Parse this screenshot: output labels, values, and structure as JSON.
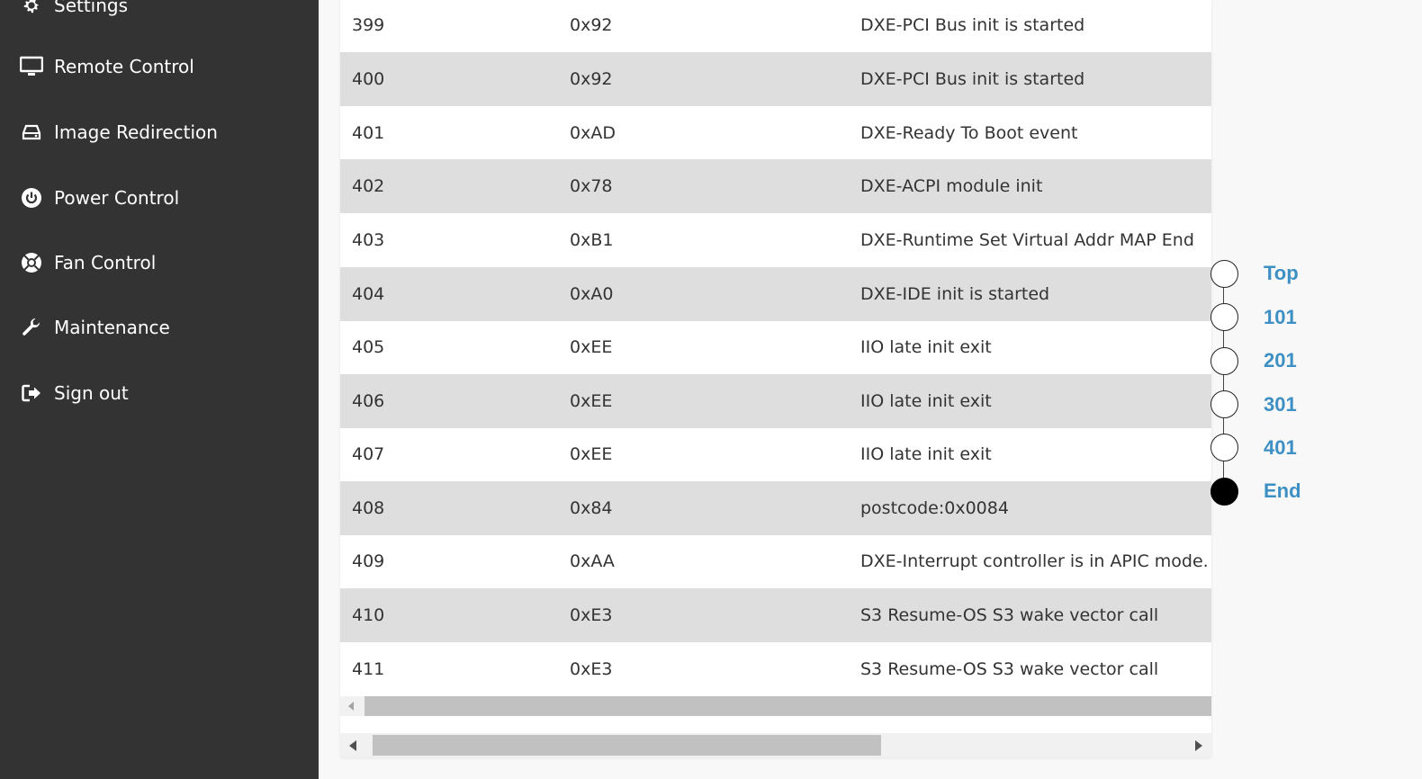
{
  "sidebar": {
    "items": [
      {
        "label": "Settings",
        "icon": "gear-icon"
      },
      {
        "label": "Remote Control",
        "icon": "monitor-icon"
      },
      {
        "label": "Image Redirection",
        "icon": "drive-icon"
      },
      {
        "label": "Power Control",
        "icon": "power-icon"
      },
      {
        "label": "Fan Control",
        "icon": "fan-icon"
      },
      {
        "label": "Maintenance",
        "icon": "wrench-icon"
      },
      {
        "label": "Sign out",
        "icon": "sign-out-icon"
      }
    ]
  },
  "table": {
    "rows": [
      {
        "id": "399",
        "code": "0x92",
        "desc": "DXE-PCI Bus init is started"
      },
      {
        "id": "400",
        "code": "0x92",
        "desc": "DXE-PCI Bus init is started"
      },
      {
        "id": "401",
        "code": "0xAD",
        "desc": "DXE-Ready To Boot event"
      },
      {
        "id": "402",
        "code": "0x78",
        "desc": "DXE-ACPI module init"
      },
      {
        "id": "403",
        "code": "0xB1",
        "desc": "DXE-Runtime Set Virtual Addr MAP End"
      },
      {
        "id": "404",
        "code": "0xA0",
        "desc": "DXE-IDE init is started"
      },
      {
        "id": "405",
        "code": "0xEE",
        "desc": "IIO late init exit"
      },
      {
        "id": "406",
        "code": "0xEE",
        "desc": "IIO late init exit"
      },
      {
        "id": "407",
        "code": "0xEE",
        "desc": "IIO late init exit"
      },
      {
        "id": "408",
        "code": "0x84",
        "desc": "postcode:0x0084"
      },
      {
        "id": "409",
        "code": "0xAA",
        "desc": "DXE-Interrupt controller is in APIC mode."
      },
      {
        "id": "410",
        "code": "0xE3",
        "desc": "S3 Resume-OS S3 wake vector call"
      },
      {
        "id": "411",
        "code": "0xE3",
        "desc": "S3 Resume-OS S3 wake vector call"
      }
    ]
  },
  "timeline": {
    "items": [
      {
        "label": "Top",
        "active": false
      },
      {
        "label": "101",
        "active": false
      },
      {
        "label": "201",
        "active": false
      },
      {
        "label": "301",
        "active": false
      },
      {
        "label": "401",
        "active": false
      },
      {
        "label": "End",
        "active": true
      }
    ]
  },
  "colors": {
    "sidebar_bg": "#333333",
    "row_alt": "#dedede",
    "link": "#3d8fc4"
  }
}
